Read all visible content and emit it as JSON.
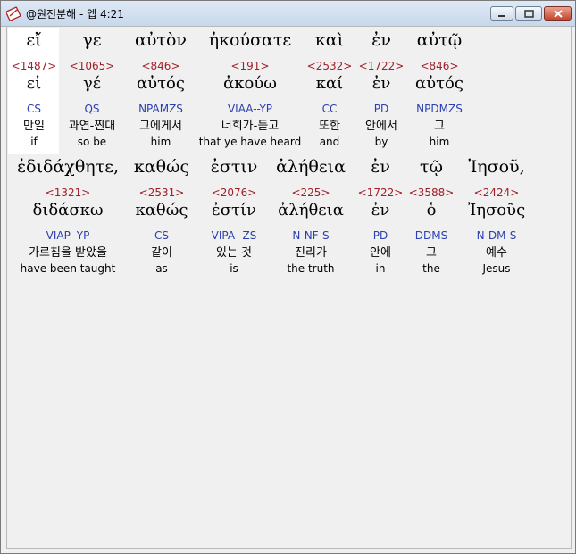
{
  "window": {
    "title": "@원전분해 - 엡 4:21"
  },
  "rows": [
    {
      "words": [
        {
          "greek": "εἴ",
          "strong": "<1487>",
          "lemma": "εἰ",
          "parse": "CS",
          "korean": "만일",
          "english": "if"
        },
        {
          "greek": "γε",
          "strong": "<1065>",
          "lemma": "γέ",
          "parse": "QS",
          "korean": "과연-찐대",
          "english": "so be"
        },
        {
          "greek": "αὐτὸν",
          "strong": "<846>",
          "lemma": "αὐτός",
          "parse": "NPAMZS",
          "korean": "그에게서",
          "english": "him"
        },
        {
          "greek": "ἠκούσατε",
          "strong": "<191>",
          "lemma": "ἀκούω",
          "parse": "VIAA--YP",
          "korean": "너희가-듣고",
          "english": "that ye have heard"
        },
        {
          "greek": "καὶ",
          "strong": "<2532>",
          "lemma": "καί",
          "parse": "CC",
          "korean": "또한",
          "english": "and"
        },
        {
          "greek": "ἐν",
          "strong": "<1722>",
          "lemma": "ἐν",
          "parse": "PD",
          "korean": "안에서",
          "english": "by"
        },
        {
          "greek": "αὐτῷ",
          "strong": "<846>",
          "lemma": "αὐτός",
          "parse": "NPDMZS",
          "korean": "그",
          "english": "him"
        }
      ]
    },
    {
      "words": [
        {
          "greek": "ἐδιδάχθητε,",
          "strong": "<1321>",
          "lemma": "διδάσκω",
          "parse": "VIAP--YP",
          "korean": "가르침을 받았을",
          "english": "have been taught"
        },
        {
          "greek": "καθώς",
          "strong": "<2531>",
          "lemma": "καθώς",
          "parse": "CS",
          "korean": "같이",
          "english": "as"
        },
        {
          "greek": "ἐστιν",
          "strong": "<2076>",
          "lemma": "ἐστίν",
          "parse": "VIPA--ZS",
          "korean": "있는 것",
          "english": "is"
        },
        {
          "greek": "ἀλήθεια",
          "strong": "<225>",
          "lemma": "ἀλήθεια",
          "parse": "N-NF-S",
          "korean": "진리가",
          "english": "the truth"
        },
        {
          "greek": "ἐν",
          "strong": "<1722>",
          "lemma": "ἐν",
          "parse": "PD",
          "korean": "안에",
          "english": "in"
        },
        {
          "greek": "τῷ",
          "strong": "<3588>",
          "lemma": "ὁ",
          "parse": "DDMS",
          "korean": "그",
          "english": "the"
        },
        {
          "greek": "Ἰησοῦ,",
          "strong": "<2424>",
          "lemma": "Ἰησοῦς",
          "parse": "N-DM-S",
          "korean": "예수",
          "english": "Jesus"
        }
      ]
    }
  ]
}
